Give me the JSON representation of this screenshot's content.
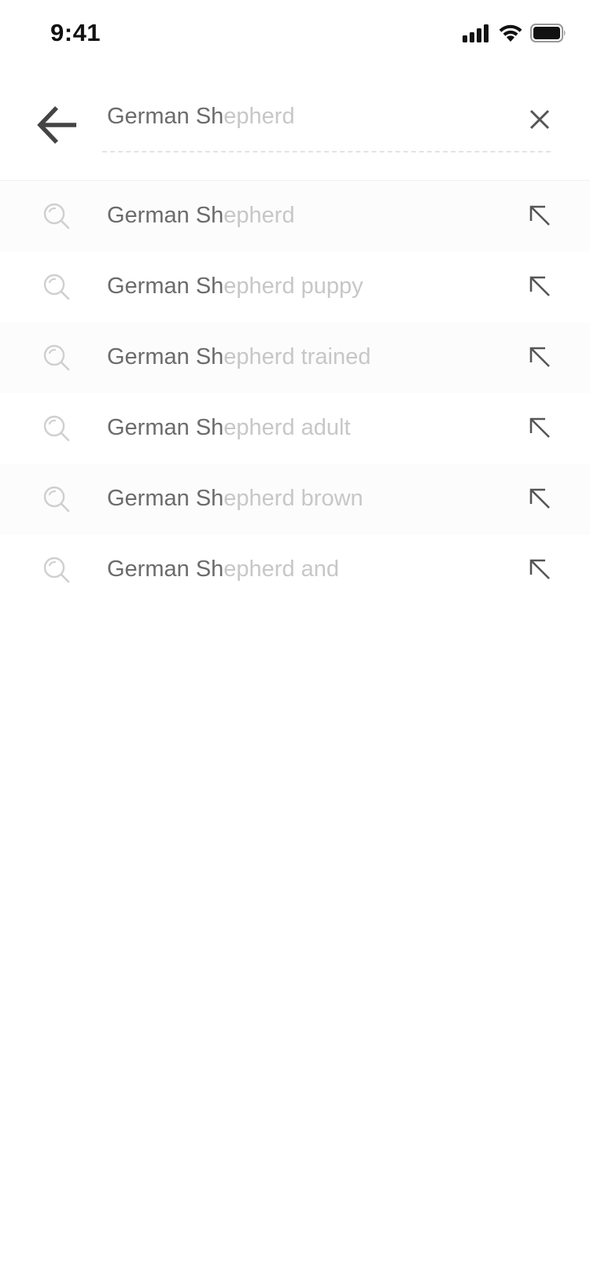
{
  "status_bar": {
    "time": "9:41",
    "icons": [
      "signal-icon",
      "wifi-icon",
      "battery-icon"
    ]
  },
  "search": {
    "typed": "German Sh",
    "completion": "epherd",
    "icons": {
      "back": "back-arrow-icon",
      "clear": "close-icon"
    }
  },
  "suggestions": [
    {
      "typed": "German Sh",
      "completion": "epherd"
    },
    {
      "typed": "German Sh",
      "completion": "epherd puppy"
    },
    {
      "typed": "German Sh",
      "completion": "epherd trained"
    },
    {
      "typed": "German Sh",
      "completion": "epherd adult"
    },
    {
      "typed": "German Sh",
      "completion": "epherd brown"
    },
    {
      "typed": "German Sh",
      "completion": "epherd and"
    }
  ],
  "colors": {
    "typed_text": "#6b6b6b",
    "hint_text": "#c7c7c7",
    "icon_dark": "#444444",
    "icon_light": "#cfcfcf",
    "row_shade": "#fcfcfc"
  }
}
